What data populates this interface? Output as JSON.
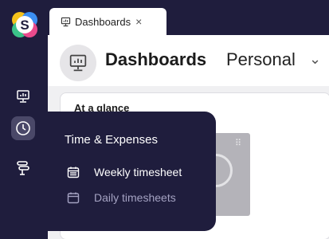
{
  "tab": {
    "label": "Dashboards",
    "close": "×"
  },
  "header": {
    "title": "Dashboards",
    "subtitle": "Personal",
    "caret": "⌄"
  },
  "panel": {
    "heading": "At a glance",
    "widget_grip": "⠿"
  },
  "flyout": {
    "heading": "Time & Expenses",
    "items": [
      {
        "label": "Weekly timesheet",
        "icon": "calendar-icon",
        "active": true
      },
      {
        "label": "Daily timesheets",
        "icon": "calendar-icon",
        "active": false
      }
    ]
  },
  "rail": {
    "items": [
      {
        "icon": "dashboard-icon",
        "active": false
      },
      {
        "icon": "clock-icon",
        "active": true
      },
      {
        "icon": "workflow-icon",
        "active": false
      }
    ]
  },
  "colors": {
    "nav_bg": "#1f1d3d",
    "active_bg": "#4a4868",
    "logo_yellow": "#f5c21b",
    "logo_blue": "#3c8ff2",
    "logo_pink": "#ea4a8c",
    "logo_green": "#3bc48a"
  }
}
